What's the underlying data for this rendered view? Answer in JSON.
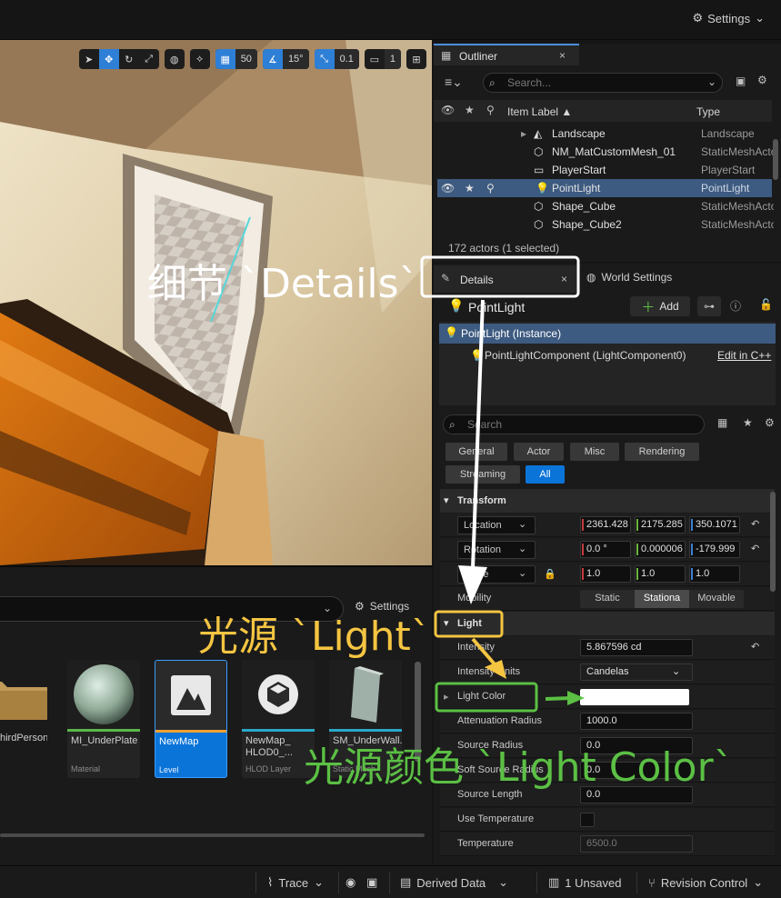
{
  "topbar": {
    "settings_label": "Settings"
  },
  "viewport": {
    "grid_snap": "50",
    "rotation_snap": "15°",
    "scale_snap": "0.1",
    "camera_speed": "1"
  },
  "content_browser": {
    "settings_label": "Settings",
    "items": [
      {
        "name": "hirdPerson",
        "type": "",
        "bar_color": "#1a1a1a"
      },
      {
        "name": "MI_UnderPlate",
        "type": "Material",
        "bar_color": "#5bb84a"
      },
      {
        "name": "NewMap",
        "type": "Level",
        "bar_color": "#f0a030"
      },
      {
        "name": "NewMap_ HLOD0_...",
        "type": "HLOD Layer",
        "bar_color": "#2aa8c8"
      },
      {
        "name": "SM_UnderWall...",
        "type": "Static Mesh",
        "bar_color": "#2aa8c8"
      }
    ]
  },
  "outliner": {
    "tab_label": "Outliner",
    "search_placeholder": "Search...",
    "col_label": "Item Label ▲",
    "col_type": "Type",
    "rows": [
      {
        "label": "Landscape",
        "type": "Landscape"
      },
      {
        "label": "NM_MatCustomMesh_01",
        "type": "StaticMeshActor"
      },
      {
        "label": "PlayerStart",
        "type": "PlayerStart"
      },
      {
        "label": "PointLight",
        "type": "PointLight"
      },
      {
        "label": "Shape_Cube",
        "type": "StaticMeshActor"
      },
      {
        "label": "Shape_Cube2",
        "type": "StaticMeshActor"
      }
    ],
    "footer": "172 actors (1 selected)"
  },
  "details": {
    "tab_label": "Details",
    "world_settings_label": "World Settings",
    "actor_name": "PointLight",
    "add_label": "Add",
    "instance_label": "PointLight (Instance)",
    "component_label": "PointLightComponent (LightComponent0)",
    "edit_cpp": "Edit in C++",
    "search_placeholder": "Search",
    "filters": [
      "General",
      "Actor",
      "Misc",
      "Rendering",
      "Streaming",
      "All"
    ],
    "transform_section": "Transform",
    "location_label": "Location",
    "location": [
      "2361.428",
      "2175.285",
      "350.1071"
    ],
    "rotation_label": "Rotation",
    "rotation": [
      "0.0 °",
      "0.000006",
      "-179.999"
    ],
    "scale_label": "Scale",
    "scale": [
      "1.0",
      "1.0",
      "1.0"
    ],
    "mobility_label": "Mobility",
    "mobility_options": [
      "Static",
      "Stationa",
      "Movable"
    ],
    "light_section": "Light",
    "intensity_label": "Intensity",
    "intensity": "5.867596 cd",
    "intensity_units_label": "Intensity Units",
    "intensity_units": "Candelas",
    "light_color_label": "Light Color",
    "light_color": "#ffffff",
    "attenuation_label": "Attenuation Radius",
    "attenuation": "1000.0",
    "source_radius_label": "Source Radius",
    "source_radius": "0.0",
    "soft_source_radius_label": "Soft Source Radius",
    "soft_source_radius": "0.0",
    "source_length_label": "Source Length",
    "source_length": "0.0",
    "use_temperature_label": "Use Temperature",
    "temperature_label": "Temperature",
    "temperature": "6500.0"
  },
  "statusbar": {
    "trace": "Trace",
    "derived_data": "Derived Data",
    "unsaved": "1 Unsaved",
    "revision_control": "Revision Control"
  },
  "annotations": {
    "details": "细节 `Details`",
    "light": "光源 `Light`",
    "light_color": "光源颜色 `Light Color`",
    "white": "#ffffff",
    "yellow": "#f5c542",
    "green": "#5bc044"
  }
}
